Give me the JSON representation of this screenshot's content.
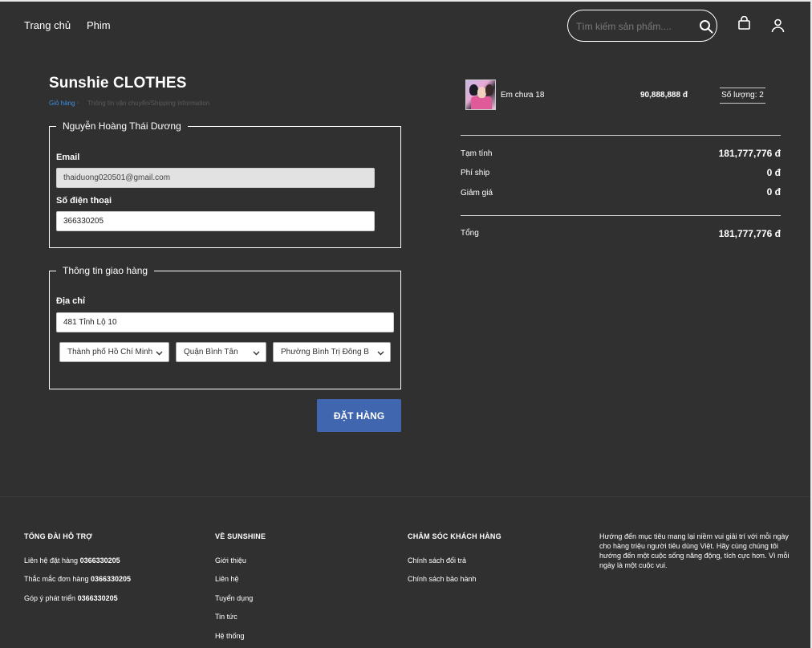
{
  "header": {
    "nav": [
      "Trang chủ",
      "Phim"
    ],
    "search_placeholder": "Tìm kiếm sản phẩm...."
  },
  "checkout": {
    "brand": "Sunshie CLOTHES",
    "breadcrumb": [
      "Giỏ hàng",
      "Thông tin vận chuyển/Shipping Information"
    ],
    "account_box": {
      "legend": "Nguyễn Hoàng Thái Dương",
      "email_label": "Email",
      "email_value": "thaiduong020501@gmail.com",
      "phone_label": "Số điện thoại",
      "phone_value": "366330205"
    },
    "shipping_box": {
      "legend": "Thông tin giao hàng",
      "address_label": "Địa chỉ",
      "address_value": "481 Tỉnh Lộ 10",
      "city": "Thành phố Hồ Chí Minh",
      "district": "Quận Bình Tân",
      "ward": "Phường Bình Trị Đông B"
    },
    "submit_label": "ĐẶT HÀNG"
  },
  "cart": {
    "item": {
      "name": "Em chưa 18",
      "price": "90,888,888 đ",
      "quantity": "Số lượng: 2"
    },
    "summary": [
      {
        "label": "Tạm tính",
        "value": "181,777,776 đ"
      },
      {
        "label": "Phí ship",
        "value": "0 đ"
      },
      {
        "label": "Giảm giá",
        "value": "0 đ"
      }
    ],
    "total_label": "Tổng",
    "total_value": "181,777,776 đ"
  },
  "footer": {
    "support": {
      "heading": "TỔNG ĐÀI HỖ TRỢ",
      "items": [
        {
          "label": "Liên hệ đặt hàng",
          "value": "0366330205"
        },
        {
          "label": "Thắc mắc đơn hàng",
          "value": "0366330205"
        },
        {
          "label": "Góp ý phát triển",
          "value": "0366330205"
        }
      ]
    },
    "about": {
      "heading": "VỀ SUNSHINE",
      "items": [
        "Giới thiệu",
        "Liên hệ",
        "Tuyển dụng",
        "Tin tức",
        "Hệ thống"
      ]
    },
    "care": {
      "heading": "CHĂM SÓC KHÁCH HÀNG",
      "items": [
        "Chính sách đổi trả",
        "Chính sách bảo hành"
      ]
    },
    "mission": "Hướng đến mục tiêu mang lại niềm vui giải trí với mỗi ngày cho hàng triệu người tiêu dùng Việt. Hãy cùng chúng tôi hướng đến một cuộc sống năng động, tích cực hơn. Vì mỗi ngày là một cuộc vui."
  }
}
